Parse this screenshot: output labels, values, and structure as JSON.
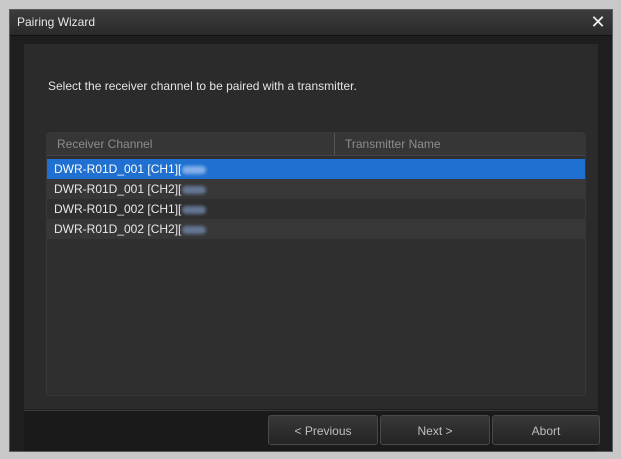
{
  "window": {
    "title": "Pairing Wizard"
  },
  "instructions": "Select the receiver channel to be paired with a transmitter.",
  "table": {
    "columns": [
      "Receiver Channel",
      "Transmitter Name"
    ],
    "rows": [
      {
        "receiver_channel": "DWR-R01D_001 [CH1][",
        "transmitter_name": "",
        "selected": true
      },
      {
        "receiver_channel": "DWR-R01D_001 [CH2][",
        "transmitter_name": ""
      },
      {
        "receiver_channel": "DWR-R01D_002 [CH1][",
        "transmitter_name": ""
      },
      {
        "receiver_channel": "DWR-R01D_002 [CH2][",
        "transmitter_name": ""
      }
    ]
  },
  "buttons": {
    "previous": "< Previous",
    "next": "Next >",
    "abort": "Abort"
  },
  "icons": {
    "close": "close-icon"
  },
  "colors": {
    "selection": "#1f70d0",
    "background": "#1e1e1e"
  }
}
